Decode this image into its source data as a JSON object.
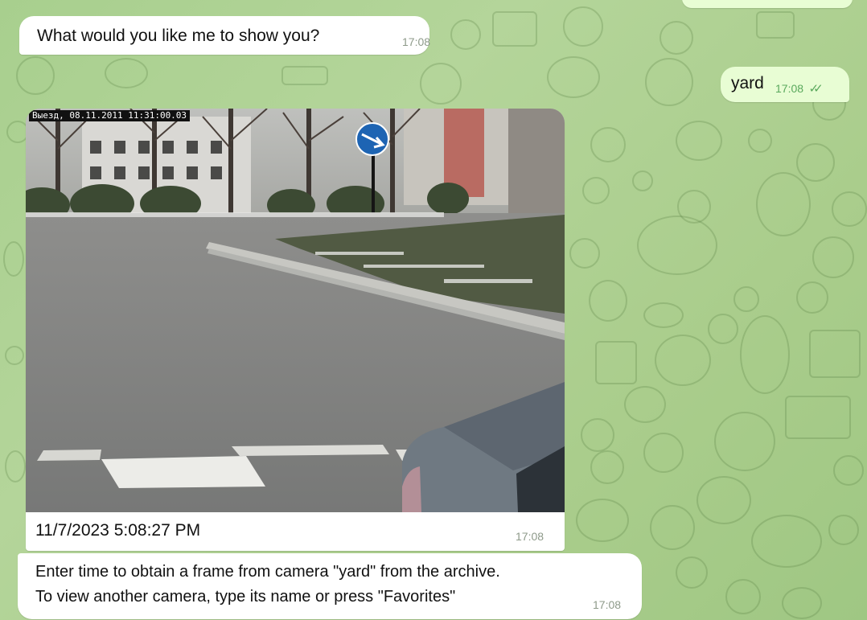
{
  "chat": {
    "messages": [
      {
        "id": "top-cut",
        "direction": "outgoing",
        "text": "",
        "time": ""
      },
      {
        "id": "question",
        "direction": "incoming",
        "text": "What would you like me to show you?",
        "time": "17:08"
      },
      {
        "id": "yard",
        "direction": "outgoing",
        "text": "yard",
        "time": "17:08",
        "status_icon": "double-check-icon"
      },
      {
        "id": "photo",
        "direction": "incoming",
        "image_overlay_text": "Выезд, 08.11.2011 11:31:00.03",
        "caption": "11/7/2023 5:08:27 PM",
        "time": "17:08"
      },
      {
        "id": "archive",
        "direction": "incoming",
        "lines": [
          "Enter time to obtain a frame from camera \"yard\" from the archive.",
          "To view another camera, type its name or press \"Favorites\""
        ],
        "time": "17:08"
      }
    ]
  },
  "colors": {
    "background": "#abd08f",
    "incoming_bubble": "#ffffff",
    "outgoing_bubble": "#e8fdd4",
    "time_incoming": "#8e9a8a",
    "time_outgoing": "#5aa95d"
  }
}
